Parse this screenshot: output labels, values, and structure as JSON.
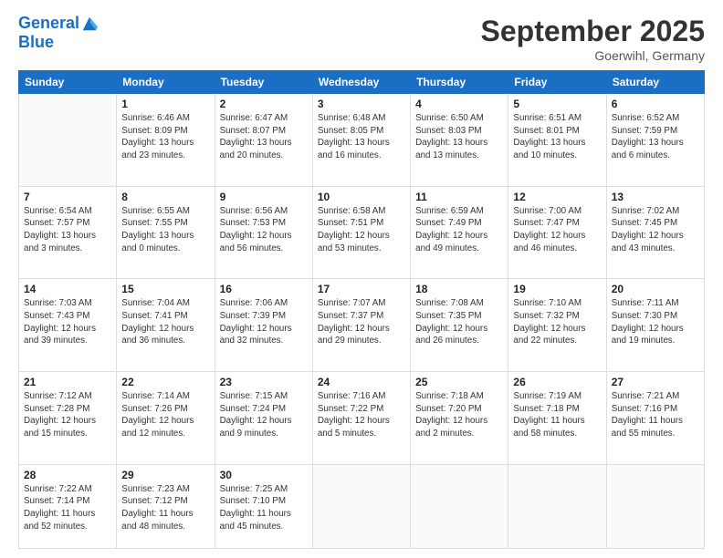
{
  "header": {
    "logo_line1": "General",
    "logo_line2": "Blue",
    "month": "September 2025",
    "location": "Goerwihl, Germany"
  },
  "weekdays": [
    "Sunday",
    "Monday",
    "Tuesday",
    "Wednesday",
    "Thursday",
    "Friday",
    "Saturday"
  ],
  "weeks": [
    [
      {
        "day": "",
        "info": ""
      },
      {
        "day": "1",
        "info": "Sunrise: 6:46 AM\nSunset: 8:09 PM\nDaylight: 13 hours\nand 23 minutes."
      },
      {
        "day": "2",
        "info": "Sunrise: 6:47 AM\nSunset: 8:07 PM\nDaylight: 13 hours\nand 20 minutes."
      },
      {
        "day": "3",
        "info": "Sunrise: 6:48 AM\nSunset: 8:05 PM\nDaylight: 13 hours\nand 16 minutes."
      },
      {
        "day": "4",
        "info": "Sunrise: 6:50 AM\nSunset: 8:03 PM\nDaylight: 13 hours\nand 13 minutes."
      },
      {
        "day": "5",
        "info": "Sunrise: 6:51 AM\nSunset: 8:01 PM\nDaylight: 13 hours\nand 10 minutes."
      },
      {
        "day": "6",
        "info": "Sunrise: 6:52 AM\nSunset: 7:59 PM\nDaylight: 13 hours\nand 6 minutes."
      }
    ],
    [
      {
        "day": "7",
        "info": "Sunrise: 6:54 AM\nSunset: 7:57 PM\nDaylight: 13 hours\nand 3 minutes."
      },
      {
        "day": "8",
        "info": "Sunrise: 6:55 AM\nSunset: 7:55 PM\nDaylight: 13 hours\nand 0 minutes."
      },
      {
        "day": "9",
        "info": "Sunrise: 6:56 AM\nSunset: 7:53 PM\nDaylight: 12 hours\nand 56 minutes."
      },
      {
        "day": "10",
        "info": "Sunrise: 6:58 AM\nSunset: 7:51 PM\nDaylight: 12 hours\nand 53 minutes."
      },
      {
        "day": "11",
        "info": "Sunrise: 6:59 AM\nSunset: 7:49 PM\nDaylight: 12 hours\nand 49 minutes."
      },
      {
        "day": "12",
        "info": "Sunrise: 7:00 AM\nSunset: 7:47 PM\nDaylight: 12 hours\nand 46 minutes."
      },
      {
        "day": "13",
        "info": "Sunrise: 7:02 AM\nSunset: 7:45 PM\nDaylight: 12 hours\nand 43 minutes."
      }
    ],
    [
      {
        "day": "14",
        "info": "Sunrise: 7:03 AM\nSunset: 7:43 PM\nDaylight: 12 hours\nand 39 minutes."
      },
      {
        "day": "15",
        "info": "Sunrise: 7:04 AM\nSunset: 7:41 PM\nDaylight: 12 hours\nand 36 minutes."
      },
      {
        "day": "16",
        "info": "Sunrise: 7:06 AM\nSunset: 7:39 PM\nDaylight: 12 hours\nand 32 minutes."
      },
      {
        "day": "17",
        "info": "Sunrise: 7:07 AM\nSunset: 7:37 PM\nDaylight: 12 hours\nand 29 minutes."
      },
      {
        "day": "18",
        "info": "Sunrise: 7:08 AM\nSunset: 7:35 PM\nDaylight: 12 hours\nand 26 minutes."
      },
      {
        "day": "19",
        "info": "Sunrise: 7:10 AM\nSunset: 7:32 PM\nDaylight: 12 hours\nand 22 minutes."
      },
      {
        "day": "20",
        "info": "Sunrise: 7:11 AM\nSunset: 7:30 PM\nDaylight: 12 hours\nand 19 minutes."
      }
    ],
    [
      {
        "day": "21",
        "info": "Sunrise: 7:12 AM\nSunset: 7:28 PM\nDaylight: 12 hours\nand 15 minutes."
      },
      {
        "day": "22",
        "info": "Sunrise: 7:14 AM\nSunset: 7:26 PM\nDaylight: 12 hours\nand 12 minutes."
      },
      {
        "day": "23",
        "info": "Sunrise: 7:15 AM\nSunset: 7:24 PM\nDaylight: 12 hours\nand 9 minutes."
      },
      {
        "day": "24",
        "info": "Sunrise: 7:16 AM\nSunset: 7:22 PM\nDaylight: 12 hours\nand 5 minutes."
      },
      {
        "day": "25",
        "info": "Sunrise: 7:18 AM\nSunset: 7:20 PM\nDaylight: 12 hours\nand 2 minutes."
      },
      {
        "day": "26",
        "info": "Sunrise: 7:19 AM\nSunset: 7:18 PM\nDaylight: 11 hours\nand 58 minutes."
      },
      {
        "day": "27",
        "info": "Sunrise: 7:21 AM\nSunset: 7:16 PM\nDaylight: 11 hours\nand 55 minutes."
      }
    ],
    [
      {
        "day": "28",
        "info": "Sunrise: 7:22 AM\nSunset: 7:14 PM\nDaylight: 11 hours\nand 52 minutes."
      },
      {
        "day": "29",
        "info": "Sunrise: 7:23 AM\nSunset: 7:12 PM\nDaylight: 11 hours\nand 48 minutes."
      },
      {
        "day": "30",
        "info": "Sunrise: 7:25 AM\nSunset: 7:10 PM\nDaylight: 11 hours\nand 45 minutes."
      },
      {
        "day": "",
        "info": ""
      },
      {
        "day": "",
        "info": ""
      },
      {
        "day": "",
        "info": ""
      },
      {
        "day": "",
        "info": ""
      }
    ]
  ]
}
